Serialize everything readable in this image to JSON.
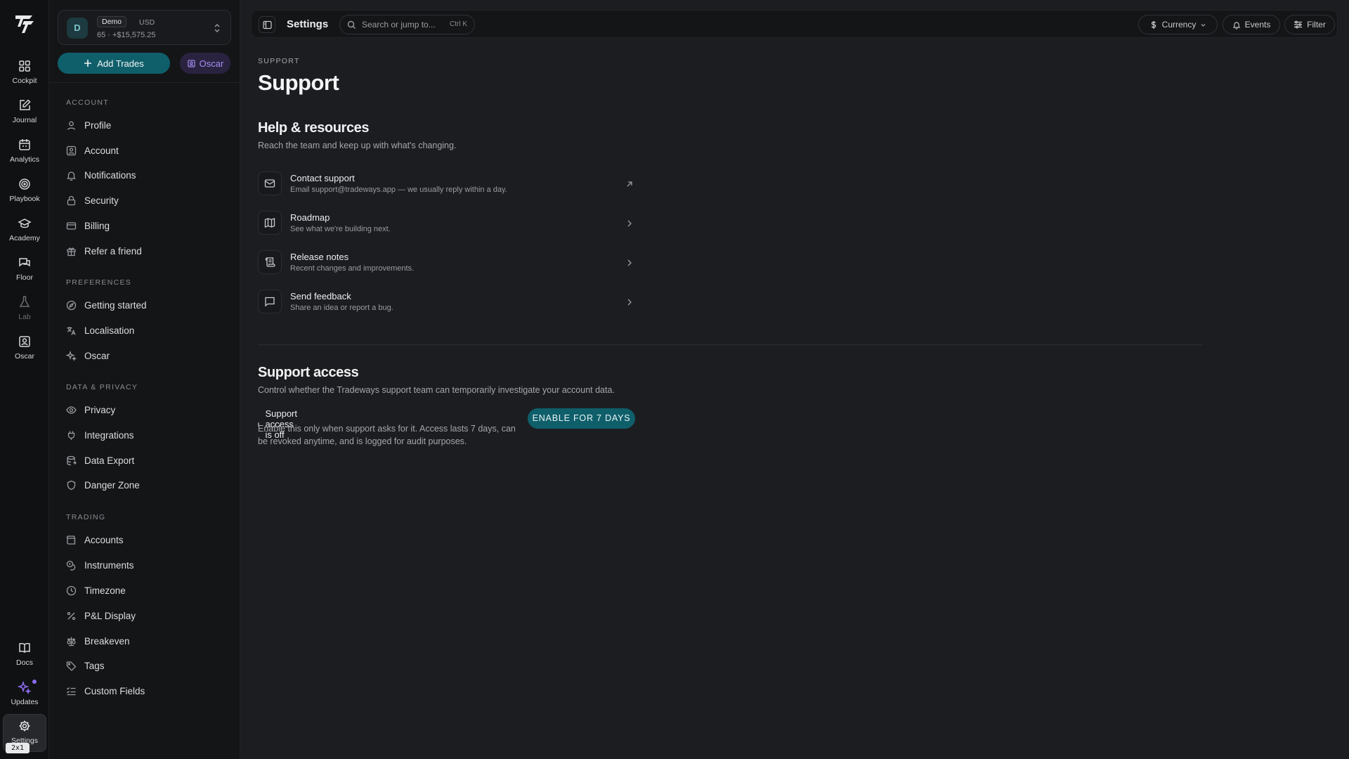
{
  "rail": {
    "logo": "logo-icon",
    "items": [
      {
        "label": "Cockpit",
        "icon": "grid-icon"
      },
      {
        "label": "Journal",
        "icon": "edit-icon"
      },
      {
        "label": "Analytics",
        "icon": "calendar-icon"
      },
      {
        "label": "Playbook",
        "icon": "target-icon"
      },
      {
        "label": "Academy",
        "icon": "graduation-cap-icon"
      },
      {
        "label": "Floor",
        "icon": "chat-icon"
      },
      {
        "label": "Lab",
        "icon": "flask-icon"
      },
      {
        "label": "Oscar",
        "icon": "user-card-icon"
      }
    ],
    "bottom": [
      {
        "label": "Docs",
        "icon": "book-icon"
      },
      {
        "label": "Updates",
        "icon": "sparkles-icon"
      },
      {
        "label": "Settings",
        "icon": "gear-icon"
      }
    ],
    "zoom_badge": "2x1"
  },
  "account_switcher": {
    "avatar": "D",
    "badge": "Demo",
    "currency": "USD",
    "summary": "65 · +$15,575.25"
  },
  "actions": {
    "add_trades": "Add Trades",
    "oscar": "Oscar"
  },
  "sidebar": {
    "sections": [
      {
        "title": "ACCOUNT",
        "items": [
          "Profile",
          "Account",
          "Notifications",
          "Security",
          "Billing",
          "Refer a friend"
        ]
      },
      {
        "title": "PREFERENCES",
        "items": [
          "Getting started",
          "Localisation",
          "Oscar"
        ]
      },
      {
        "title": "DATA & PRIVACY",
        "items": [
          "Privacy",
          "Integrations",
          "Data Export",
          "Danger Zone"
        ]
      },
      {
        "title": "TRADING",
        "items": [
          "Accounts",
          "Instruments",
          "Timezone",
          "P&L Display",
          "Breakeven",
          "Tags",
          "Custom Fields"
        ]
      }
    ]
  },
  "topbar": {
    "title": "Settings",
    "search_placeholder": "Search or jump to...",
    "search_shortcut": "Ctrl K",
    "currency": "Currency",
    "events": "Events",
    "filter": "Filter"
  },
  "page": {
    "eyebrow": "SUPPORT",
    "title": "Support",
    "help": {
      "title": "Help & resources",
      "subtitle": "Reach the team and keep up with what's changing.",
      "items": [
        {
          "title": "Contact support",
          "desc": "Email support@tradeways.app — we usually reply within a day.",
          "icon": "mail-icon",
          "arrow": "external-link-icon"
        },
        {
          "title": "Roadmap",
          "desc": "See what we're building next.",
          "icon": "map-icon",
          "arrow": "chevron-right-icon"
        },
        {
          "title": "Release notes",
          "desc": "Recent changes and improvements.",
          "icon": "scroll-icon",
          "arrow": "chevron-right-icon"
        },
        {
          "title": "Send feedback",
          "desc": "Share an idea or report a bug.",
          "icon": "message-square-icon",
          "arrow": "chevron-right-icon"
        }
      ]
    },
    "support_access": {
      "title": "Support access",
      "subtitle": "Control whether the Tradeways support team can temporarily investigate your account data.",
      "status": "Support access is off",
      "desc": "Enable this only when support asks for it. Access lasts 7 days, can be revoked anytime, and is logged for audit purposes.",
      "button": "ENABLE FOR 7 DAYS"
    }
  }
}
